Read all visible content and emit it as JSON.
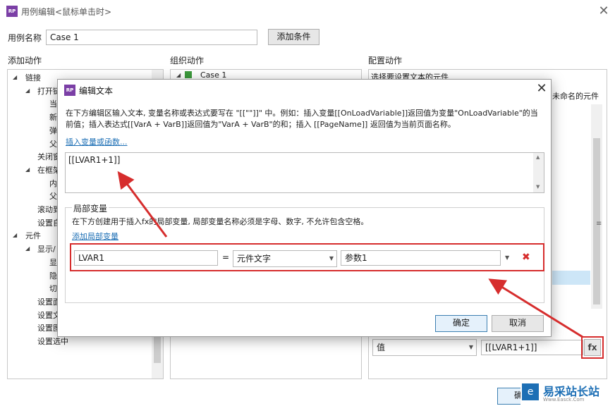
{
  "window": {
    "title": "用例编辑<鼠标单击时>",
    "icon_text": "RP",
    "close_icon": "close-icon"
  },
  "case_name": {
    "label": "用例名称",
    "value": "Case 1",
    "add_condition_label": "添加条件"
  },
  "sections": {
    "add_action": "添加动作",
    "organize_action": "组织动作",
    "configure_action": "配置动作"
  },
  "add_action_tree": [
    {
      "label": "链接",
      "level": 0
    },
    {
      "label": "打开链",
      "level": 1
    },
    {
      "label": "当",
      "level": 2
    },
    {
      "label": "新",
      "level": 2
    },
    {
      "label": "弹",
      "level": 2
    },
    {
      "label": "父",
      "level": 2
    },
    {
      "label": "关闭窗",
      "level": 1
    },
    {
      "label": "在框架",
      "level": 1
    },
    {
      "label": "内",
      "level": 2
    },
    {
      "label": "父",
      "level": 2
    },
    {
      "label": "滚动到",
      "level": 1
    },
    {
      "label": "设置自",
      "level": 1
    },
    {
      "label": "元件",
      "level": 0
    },
    {
      "label": "显示/",
      "level": 1
    },
    {
      "label": "显",
      "level": 2
    },
    {
      "label": "隐",
      "level": 2
    },
    {
      "label": "切",
      "level": 2
    },
    {
      "label": "设置面",
      "level": 1
    },
    {
      "label": "设置文本",
      "level": 1
    },
    {
      "label": "设置图片",
      "level": 1
    },
    {
      "label": "设置选中",
      "level": 1
    }
  ],
  "organize_tree": {
    "case_label": "Case 1"
  },
  "configure": {
    "select_widget_text": "选择要设置文本的元件",
    "unnamed_widget_text": "未命名的元件",
    "value_type": "值",
    "value_text": "[[LVAR1+1]]",
    "fx_label": "fx",
    "ok_label": "确"
  },
  "dialog": {
    "title": "编辑文本",
    "icon_text": "RP",
    "description": "在下方编辑区输入文本, 变量名称或表达式要写在 \"[[\"\"]]\" 中。例如：插入变量[[OnLoadVariable]]返回值为变量\"OnLoadVariable\"的当前值；插入表达式[[VarA + VarB]]返回值为\"VarA + VarB\"的和；插入 [[PageName]] 返回值为当前页面名称。",
    "insert_link": "插入变量或函数...",
    "edit_value": "[[LVAR1+1]]",
    "local_vars": {
      "title": "局部变量",
      "description": "在下方创建用于插入fx的局部变量, 局部变量名称必须是字母、数字, 不允许包含空格。",
      "add_link": "添加局部变量",
      "row": {
        "name": "LVAR1",
        "equals": "=",
        "type": "元件文字",
        "target": "参数1",
        "delete_icon": "delete-x-icon"
      }
    },
    "ok_label": "确定",
    "cancel_label": "取消"
  },
  "watermark": {
    "text": "易采站长站",
    "subtext": "Www.Easck.Com"
  },
  "colors": {
    "annotation_red": "#d62d2d",
    "link_blue": "#1d6fb5",
    "app_icon_purple": "#7b3fa6",
    "ok_button_border": "#3c7fb1"
  }
}
